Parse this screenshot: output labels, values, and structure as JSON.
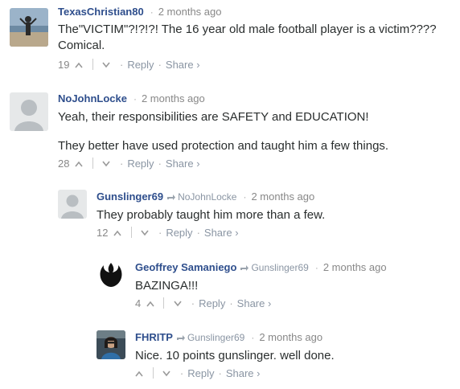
{
  "comments": [
    {
      "author": "TexasChristian80",
      "time": "2 months ago",
      "text_lines": [
        "The\"VICTIM\"?!?!?! The 16 year old male football player is a victim????",
        "Comical."
      ],
      "votes": "19",
      "reply": "Reply",
      "share": "Share ›"
    },
    {
      "author": "NoJohnLocke",
      "time": "2 months ago",
      "text_lines": [
        "Yeah, their responsibilities are SAFETY and EDUCATION!",
        "They better have used protection and taught him a few things."
      ],
      "votes": "28",
      "reply": "Reply",
      "share": "Share ›"
    },
    {
      "author": "Gunslinger69",
      "reply_to": "NoJohnLocke",
      "time": "2 months ago",
      "text_lines": [
        "They probably taught him more than a few."
      ],
      "votes": "12",
      "reply": "Reply",
      "share": "Share ›"
    },
    {
      "author": "Geoffrey Samaniego",
      "reply_to": "Gunslinger69",
      "time": "2 months ago",
      "text_lines": [
        "BAZINGA!!!"
      ],
      "votes": "4",
      "reply": "Reply",
      "share": "Share ›"
    },
    {
      "author": "FHRITP",
      "reply_to": "Gunslinger69",
      "time": "2 months ago",
      "text_lines": [
        "Nice. 10 points gunslinger. well done."
      ],
      "votes": "",
      "reply": "Reply",
      "share": "Share ›"
    }
  ],
  "colors": {
    "author": "#2e4e8c",
    "meta": "#888888",
    "link": "#8a95a3",
    "text": "#2a2e2e"
  }
}
